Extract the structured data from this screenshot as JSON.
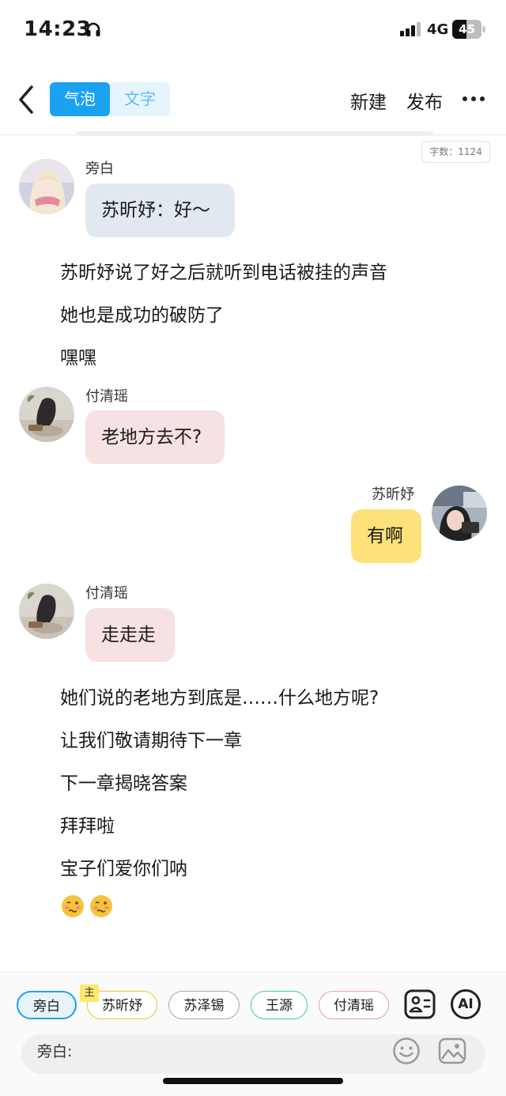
{
  "status_bar": {
    "time": "14:23",
    "network": "4G",
    "battery": "45"
  },
  "header": {
    "tabs": [
      {
        "label": "气泡",
        "active": true
      },
      {
        "label": "文字",
        "active": false
      }
    ],
    "new_label": "新建",
    "publish_label": "发布"
  },
  "word_count": "字数：1124",
  "messages": [
    {
      "name": "旁白",
      "text": "苏昕妤：好～"
    },
    {
      "name": "付清瑶",
      "text": "老地方去不?"
    },
    {
      "name": "苏昕妤",
      "text": "有啊"
    },
    {
      "name": "付清瑶",
      "text": "走走走"
    }
  ],
  "narration": {
    "block1": [
      "苏昕妤说了好之后就听到电话被挂的声音",
      "她也是成功的破防了",
      "嘿嘿"
    ],
    "block2": [
      "她们说的老地方到底是……什么地方呢?",
      "让我们敬请期待下一章",
      "下一章揭晓答案",
      "拜拜啦",
      "宝子们爱你们呐"
    ]
  },
  "bottom": {
    "characters": [
      "旁白",
      "苏昕妤",
      "苏泽锡",
      "王源",
      "付清瑶"
    ],
    "main_badge": "主",
    "ai_label": "AI",
    "input_label": "旁白:"
  },
  "colors": {
    "accent": "#1aa1f0",
    "bubble_narrator": "#e2e8f0",
    "bubble_pink": "#f6e1e3",
    "bubble_self": "#fde27b"
  }
}
